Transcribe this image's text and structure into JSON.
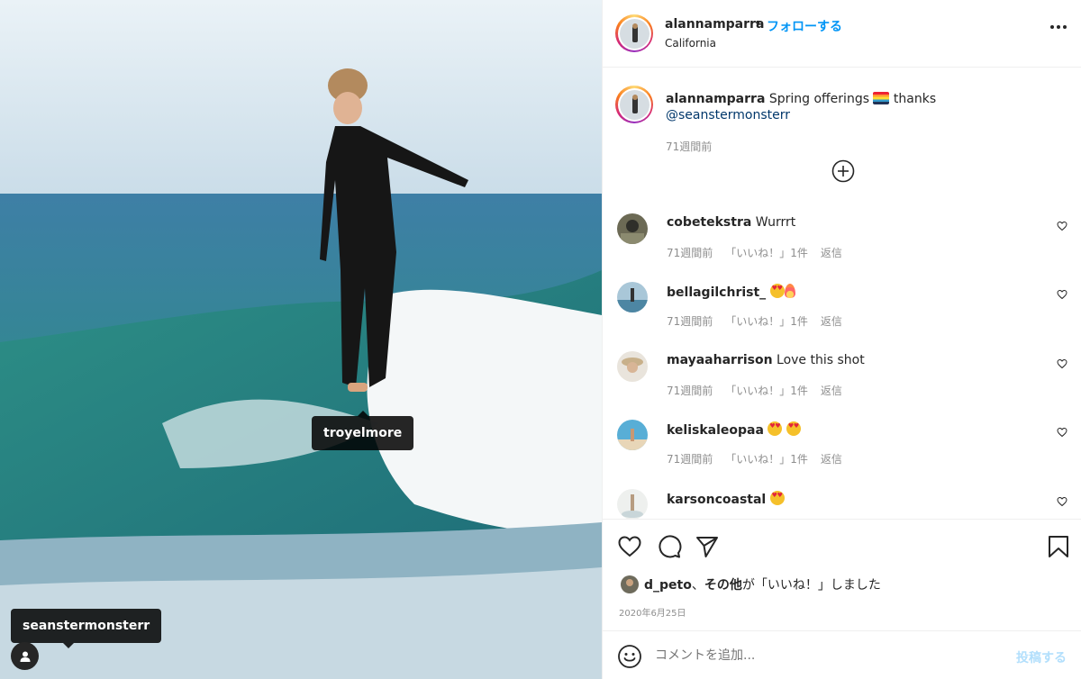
{
  "header": {
    "username": "alannamparra",
    "separator": "•",
    "follow_label": "フォローする",
    "location": "California"
  },
  "caption": {
    "username": "alannamparra",
    "text_before": "Spring offerings",
    "text_after": "thanks",
    "mention": "@seanstermonsterr",
    "time": "71週間前"
  },
  "comments": [
    {
      "username": "cobetekstra",
      "text": "Wurrrt",
      "time": "71週間前",
      "likes": "「いいね！」1件",
      "reply": "返信"
    },
    {
      "username": "bellagilchrist_",
      "text": "",
      "time": "71週間前",
      "likes": "「いいね！」1件",
      "reply": "返信"
    },
    {
      "username": "mayaaharrison",
      "text": "Love this shot",
      "time": "71週間前",
      "likes": "「いいね！」1件",
      "reply": "返信"
    },
    {
      "username": "keliskaleopaa",
      "text": "",
      "time": "71週間前",
      "likes": "「いいね！」1件",
      "reply": "返信"
    },
    {
      "username": "karsoncoastal",
      "text": "",
      "time": "",
      "likes": "",
      "reply": ""
    }
  ],
  "likes_line": {
    "user": "d_peto",
    "sep": "、",
    "others": "その他",
    "suffix": "が「いいね！」しました"
  },
  "date": "2020年6月25日",
  "add_comment": {
    "placeholder": "コメントを追加...",
    "post_label": "投稿する"
  },
  "photo_tags": {
    "tag1": "troyelmore",
    "tag2": "seanstermonsterr"
  },
  "colors": {
    "link": "#0095f6",
    "mention": "#00376b",
    "muted": "#8e8e8e",
    "post_disabled": "#b2dffc"
  },
  "icons": [
    "more-icon",
    "add-comment-plus-icon",
    "heart-icon",
    "comment-icon",
    "share-icon",
    "bookmark-icon",
    "smile-icon",
    "user-tag-icon"
  ]
}
